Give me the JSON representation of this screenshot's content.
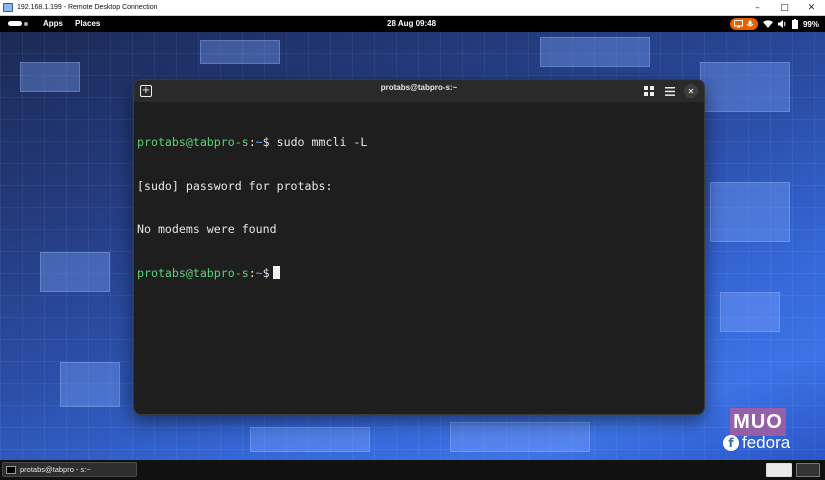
{
  "rdp_window": {
    "title": "192.168.1.199 - Remote Desktop Connection",
    "icon": "remote-desktop-icon",
    "controls": [
      "minimize",
      "maximize",
      "close"
    ]
  },
  "top_panel": {
    "activities_icon": "activities-indicator-icon",
    "apps_label": "Apps",
    "places_label": "Places",
    "clock": "28 Aug  09:48",
    "indicators": [
      "screen-share-icon",
      "audio-icon",
      "wifi-icon",
      "volume-icon",
      "battery-icon"
    ],
    "battery_percent": "99%",
    "accent_color": "#e66100"
  },
  "terminal": {
    "title": "protabs@tabpro-s:~",
    "icons": [
      "new-tab-icon",
      "grid-view-icon",
      "hamburger-menu-icon",
      "close-icon"
    ],
    "lines": [
      {
        "user": "protabs@tabpro-s",
        "sep": ":",
        "path": "~",
        "symbol": "$",
        "command": " sudo mmcli -L"
      },
      {
        "text": "[sudo] password for protabs:"
      },
      {
        "text": "No modems were found"
      },
      {
        "user": "protabs@tabpro-s",
        "sep": ":",
        "path": "~",
        "symbol": "$",
        "command": ""
      }
    ]
  },
  "watermarks": {
    "muo": "MUO",
    "fedora": "fedora"
  },
  "taskbar": {
    "window_label": "protabs@tabpro - s:~",
    "window_icon": "terminal-icon"
  }
}
